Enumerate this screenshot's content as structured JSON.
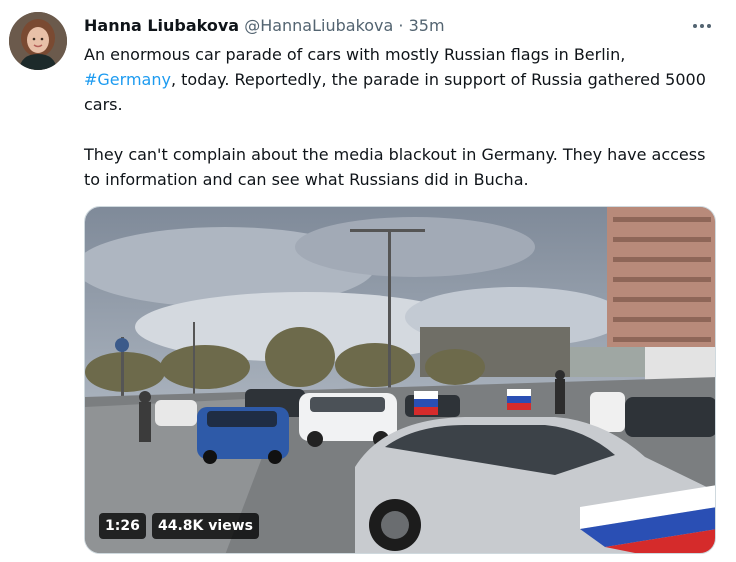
{
  "tweet": {
    "author_name": "Hanna Liubakova",
    "author_handle": "@HannaLiubakova",
    "separator": "·",
    "timestamp": "35m",
    "text_p1_before": "An enormous car parade of cars with mostly Russian flags in Berlin, ",
    "hashtag": "#Germany",
    "text_p1_after": ", today. Reportedly, the parade in support of Russia gathered 5000 cars.",
    "text_p2": "They can't complain about the media blackout in Germany. They have access to information and can see what Russians did in Bucha."
  },
  "media": {
    "duration": "1:26",
    "views": "44.8K views"
  },
  "icons": {
    "more": "more-horizontal-icon"
  }
}
